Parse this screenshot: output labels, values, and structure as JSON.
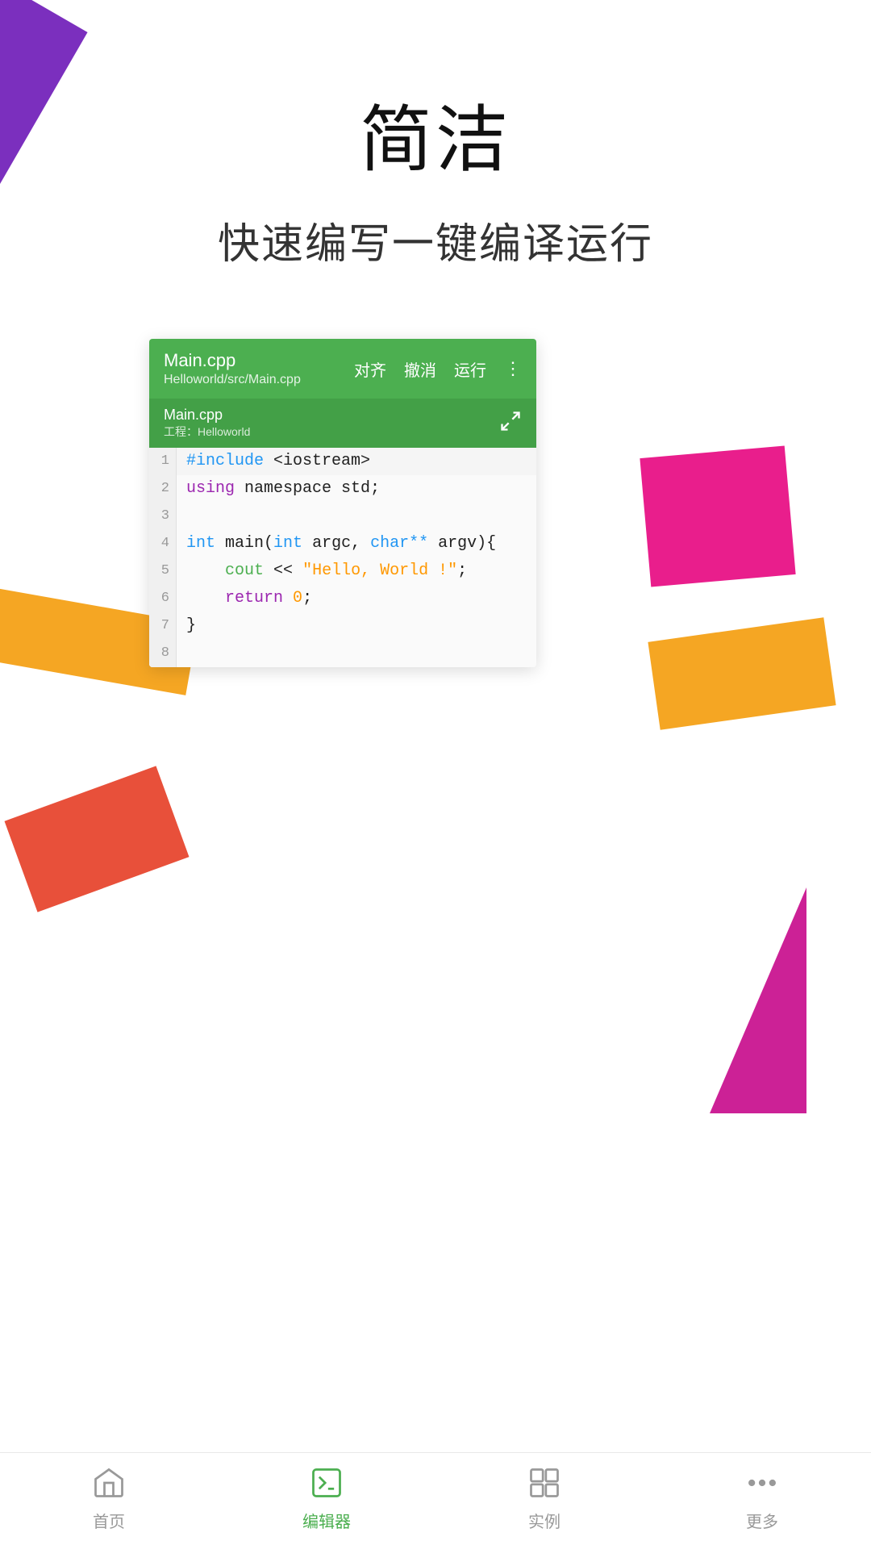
{
  "page": {
    "title": "简洁",
    "subtitle": "快速编写一键编译运行"
  },
  "editor": {
    "filename": "Main.cpp",
    "filepath": "Helloworld/src/Main.cpp",
    "tab_name": "Main.cpp",
    "tab_project": "工程：Helloworld",
    "action_align": "对齐",
    "action_undo": "撤消",
    "action_run": "运行",
    "code_lines": [
      {
        "num": "1",
        "content": "#include <iostream>"
      },
      {
        "num": "2",
        "content": "using namespace std;"
      },
      {
        "num": "3",
        "content": ""
      },
      {
        "num": "4",
        "content": "int  main(int argc, char** argv){"
      },
      {
        "num": "5",
        "content": "    cout << \"Hello, World!\";"
      },
      {
        "num": "6",
        "content": "    return 0;"
      },
      {
        "num": "7",
        "content": "  }"
      },
      {
        "num": "8",
        "content": ""
      }
    ]
  },
  "nav": {
    "items": [
      {
        "label": "首页",
        "active": false,
        "icon": "home-icon"
      },
      {
        "label": "编辑器",
        "active": true,
        "icon": "editor-icon"
      },
      {
        "label": "实例",
        "active": false,
        "icon": "examples-icon"
      },
      {
        "label": "更多",
        "active": false,
        "icon": "more-icon"
      }
    ]
  }
}
